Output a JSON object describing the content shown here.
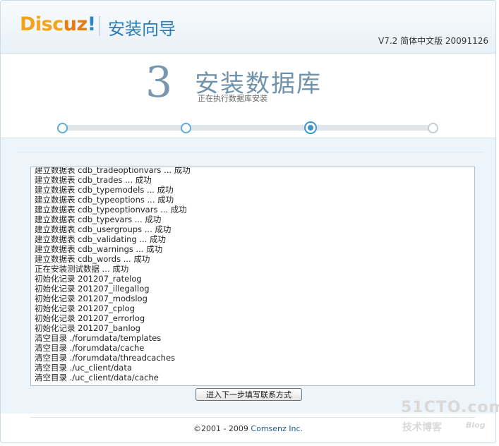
{
  "header": {
    "logo_part1": "Disc",
    "logo_part2": "uz",
    "logo_part3": "!",
    "title": "安装向导",
    "version": "V7.2 简体中文版 20091126"
  },
  "step": {
    "number": "3",
    "title": "安装数据库",
    "subtitle": "正在执行数据库安装",
    "current": 3,
    "total": 4
  },
  "log": [
    "建立数据表 cdb_tradeoptionvars ... 成功",
    "建立数据表 cdb_trades ... 成功",
    "建立数据表 cdb_typemodels ... 成功",
    "建立数据表 cdb_typeoptions ... 成功",
    "建立数据表 cdb_typeoptionvars ... 成功",
    "建立数据表 cdb_typevars ... 成功",
    "建立数据表 cdb_usergroups ... 成功",
    "建立数据表 cdb_validating ... 成功",
    "建立数据表 cdb_warnings ... 成功",
    "建立数据表 cdb_words ... 成功",
    "正在安装测试数据 ... 成功",
    "初始化记录 201207_ratelog",
    "初始化记录 201207_illegallog",
    "初始化记录 201207_modslog",
    "初始化记录 201207_cplog",
    "初始化记录 201207_errorlog",
    "初始化记录 201207_banlog",
    "清空目录 ./forumdata/templates",
    "清空目录 ./forumdata/cache",
    "清空目录 ./forumdata/threadcaches",
    "清空目录 ./uc_client/data",
    "清空目录 ./uc_client/data/cache"
  ],
  "next_button": "进入下一步填写联系方式",
  "footer": {
    "copyright": "©2001 - 2009 ",
    "company": "Comsenz Inc."
  },
  "watermark": {
    "site": "51CTO.com",
    "tagline": "技术博客",
    "blog": "Blog"
  },
  "colors": {
    "accent": "#2a7cb6",
    "logo_orange": "#f4a418",
    "progress_active": "#3d95cc"
  }
}
